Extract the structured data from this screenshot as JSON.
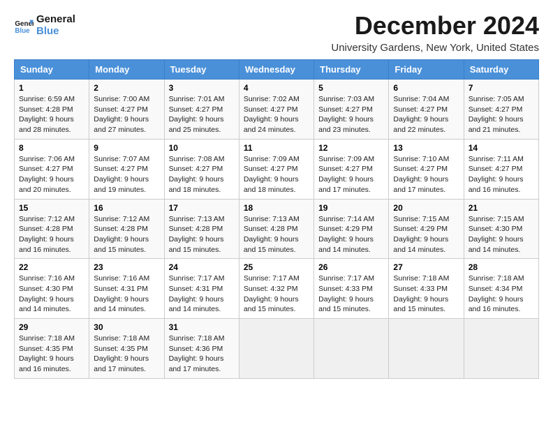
{
  "logo": {
    "line1": "General",
    "line2": "Blue"
  },
  "title": "December 2024",
  "subtitle": "University Gardens, New York, United States",
  "days_header": [
    "Sunday",
    "Monday",
    "Tuesday",
    "Wednesday",
    "Thursday",
    "Friday",
    "Saturday"
  ],
  "weeks": [
    [
      {
        "num": "1",
        "sunrise": "6:59 AM",
        "sunset": "4:28 PM",
        "daylight": "9 hours and 28 minutes."
      },
      {
        "num": "2",
        "sunrise": "7:00 AM",
        "sunset": "4:27 PM",
        "daylight": "9 hours and 27 minutes."
      },
      {
        "num": "3",
        "sunrise": "7:01 AM",
        "sunset": "4:27 PM",
        "daylight": "9 hours and 25 minutes."
      },
      {
        "num": "4",
        "sunrise": "7:02 AM",
        "sunset": "4:27 PM",
        "daylight": "9 hours and 24 minutes."
      },
      {
        "num": "5",
        "sunrise": "7:03 AM",
        "sunset": "4:27 PM",
        "daylight": "9 hours and 23 minutes."
      },
      {
        "num": "6",
        "sunrise": "7:04 AM",
        "sunset": "4:27 PM",
        "daylight": "9 hours and 22 minutes."
      },
      {
        "num": "7",
        "sunrise": "7:05 AM",
        "sunset": "4:27 PM",
        "daylight": "9 hours and 21 minutes."
      }
    ],
    [
      {
        "num": "8",
        "sunrise": "7:06 AM",
        "sunset": "4:27 PM",
        "daylight": "9 hours and 20 minutes."
      },
      {
        "num": "9",
        "sunrise": "7:07 AM",
        "sunset": "4:27 PM",
        "daylight": "9 hours and 19 minutes."
      },
      {
        "num": "10",
        "sunrise": "7:08 AM",
        "sunset": "4:27 PM",
        "daylight": "9 hours and 18 minutes."
      },
      {
        "num": "11",
        "sunrise": "7:09 AM",
        "sunset": "4:27 PM",
        "daylight": "9 hours and 18 minutes."
      },
      {
        "num": "12",
        "sunrise": "7:09 AM",
        "sunset": "4:27 PM",
        "daylight": "9 hours and 17 minutes."
      },
      {
        "num": "13",
        "sunrise": "7:10 AM",
        "sunset": "4:27 PM",
        "daylight": "9 hours and 17 minutes."
      },
      {
        "num": "14",
        "sunrise": "7:11 AM",
        "sunset": "4:27 PM",
        "daylight": "9 hours and 16 minutes."
      }
    ],
    [
      {
        "num": "15",
        "sunrise": "7:12 AM",
        "sunset": "4:28 PM",
        "daylight": "9 hours and 16 minutes."
      },
      {
        "num": "16",
        "sunrise": "7:12 AM",
        "sunset": "4:28 PM",
        "daylight": "9 hours and 15 minutes."
      },
      {
        "num": "17",
        "sunrise": "7:13 AM",
        "sunset": "4:28 PM",
        "daylight": "9 hours and 15 minutes."
      },
      {
        "num": "18",
        "sunrise": "7:13 AM",
        "sunset": "4:28 PM",
        "daylight": "9 hours and 15 minutes."
      },
      {
        "num": "19",
        "sunrise": "7:14 AM",
        "sunset": "4:29 PM",
        "daylight": "9 hours and 14 minutes."
      },
      {
        "num": "20",
        "sunrise": "7:15 AM",
        "sunset": "4:29 PM",
        "daylight": "9 hours and 14 minutes."
      },
      {
        "num": "21",
        "sunrise": "7:15 AM",
        "sunset": "4:30 PM",
        "daylight": "9 hours and 14 minutes."
      }
    ],
    [
      {
        "num": "22",
        "sunrise": "7:16 AM",
        "sunset": "4:30 PM",
        "daylight": "9 hours and 14 minutes."
      },
      {
        "num": "23",
        "sunrise": "7:16 AM",
        "sunset": "4:31 PM",
        "daylight": "9 hours and 14 minutes."
      },
      {
        "num": "24",
        "sunrise": "7:17 AM",
        "sunset": "4:31 PM",
        "daylight": "9 hours and 14 minutes."
      },
      {
        "num": "25",
        "sunrise": "7:17 AM",
        "sunset": "4:32 PM",
        "daylight": "9 hours and 15 minutes."
      },
      {
        "num": "26",
        "sunrise": "7:17 AM",
        "sunset": "4:33 PM",
        "daylight": "9 hours and 15 minutes."
      },
      {
        "num": "27",
        "sunrise": "7:18 AM",
        "sunset": "4:33 PM",
        "daylight": "9 hours and 15 minutes."
      },
      {
        "num": "28",
        "sunrise": "7:18 AM",
        "sunset": "4:34 PM",
        "daylight": "9 hours and 16 minutes."
      }
    ],
    [
      {
        "num": "29",
        "sunrise": "7:18 AM",
        "sunset": "4:35 PM",
        "daylight": "9 hours and 16 minutes."
      },
      {
        "num": "30",
        "sunrise": "7:18 AM",
        "sunset": "4:35 PM",
        "daylight": "9 hours and 17 minutes."
      },
      {
        "num": "31",
        "sunrise": "7:18 AM",
        "sunset": "4:36 PM",
        "daylight": "9 hours and 17 minutes."
      },
      null,
      null,
      null,
      null
    ]
  ],
  "labels": {
    "sunrise": "Sunrise:",
    "sunset": "Sunset:",
    "daylight": "Daylight:"
  }
}
